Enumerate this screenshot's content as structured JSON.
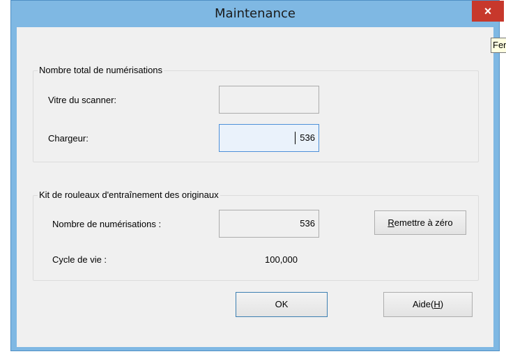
{
  "window": {
    "title": "Maintenance",
    "close_glyph": "×",
    "close_tooltip": "Fermer"
  },
  "total_scans": {
    "group_title": "Nombre total de numérisations",
    "glass_label": "Vitre du scanner:",
    "glass_value": "",
    "feeder_label": "Chargeur:",
    "feeder_value": "536"
  },
  "roller_kit": {
    "group_title": "Kit de rouleaux d'entraînement des originaux",
    "scans_label": "Nombre de numérisations :",
    "scans_value": "536",
    "reset_button": {
      "accel": "R",
      "rest": "emettre à zéro"
    },
    "life_label": "Cycle de vie :",
    "life_value": "100,000"
  },
  "buttons": {
    "ok": "OK",
    "help": {
      "text": "Aide(",
      "accel": "H",
      "close": ")"
    }
  },
  "colors": {
    "titlebar": "#7fb8e3",
    "close": "#c7382c",
    "client": "#f0f0f0",
    "focus_border": "#4d90d8"
  }
}
